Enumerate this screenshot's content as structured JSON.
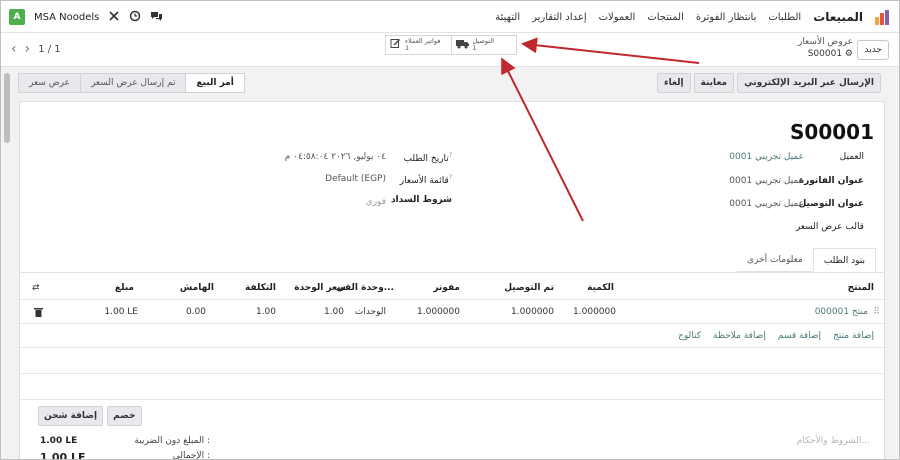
{
  "navbar": {
    "brand": "المبيعات",
    "menu": [
      "الطلبات",
      "بانتظار الفوترة",
      "المنتجات",
      "العمولات",
      "إعداد التقارير",
      "التهيئة"
    ],
    "company": "MSA Noodels",
    "avatar_letter": "A"
  },
  "control": {
    "new_label": "جديد",
    "breadcrumb_parent": "عروض الأسعار",
    "breadcrumb_current": "S00001",
    "pager": "1 / 1",
    "smart_delivery_label": "التوصيل",
    "smart_delivery_count": "1",
    "smart_invoices_label": "فواتير العملاء",
    "smart_invoices_count": "1"
  },
  "actions": {
    "buttons": [
      "الإرسال عبر البريد الإلكتروني",
      "معاينة",
      "إلغاء"
    ],
    "statuses": [
      "أمر البيع",
      "تم إرسال عرض السعر",
      "عرض سعر"
    ],
    "active_status": "أمر البيع"
  },
  "form": {
    "name": "S00001",
    "customer_label": "العميل",
    "customer_value": "عميل تجريبي 0001",
    "invoice_addr_label": "عنوان الفاتورة",
    "invoice_addr_value": "عميل تجريبي 0001",
    "delivery_addr_label": "عنوان التوصيل",
    "delivery_addr_value": "عميل تجريبي 0001",
    "template_label": "قالب عرض السعر",
    "order_date_label": "تاريخ الطلب",
    "order_date_value": "٠٤ يوليو, ٢٠٢٦ ٠٤:٥٨:٠٤ م",
    "pricelist_label": "قائمة الأسعار",
    "pricelist_value": "Default (EGP)",
    "payment_terms_label": "شروط السداد",
    "payment_terms_value": "فوري"
  },
  "tabs": [
    "بنود الطلب",
    "معلومات أخرى"
  ],
  "table": {
    "headers": {
      "product": "المنتج",
      "qty": "الكمية",
      "delivered": "تم التوصيل",
      "invoiced": "مفوتر",
      "uom": "وحدة القي...",
      "price": "سعر الوحدة",
      "cost": "التكلفة",
      "margin": "الهامش",
      "amount": "مبلغ"
    },
    "rows": [
      {
        "product": "منتج 000001",
        "qty": "1.000000",
        "delivered": "1.000000",
        "invoiced": "1.000000",
        "uom": "الوحدات",
        "price": "1.00",
        "cost": "1.00",
        "margin": "0.00",
        "amount": "1.00 LE"
      }
    ],
    "add_links": [
      "إضافة منتج",
      "إضافة قسم",
      "إضافة ملاحظة",
      "كتالوج"
    ]
  },
  "bottom": {
    "discount_label": "خصم",
    "shipping_label": "إضافة شحن",
    "terms_placeholder": "الشروط والأحكام...",
    "untaxed_label": "المبلغ دون الضريبة :",
    "untaxed_value": "1.00 LE",
    "total_label": "الإجمالي :",
    "total_value": "1.00 LE"
  },
  "colors": {
    "annotation_arrow": "#c0282d",
    "link": "#4a7a7a",
    "avatar": "#4caf50"
  }
}
